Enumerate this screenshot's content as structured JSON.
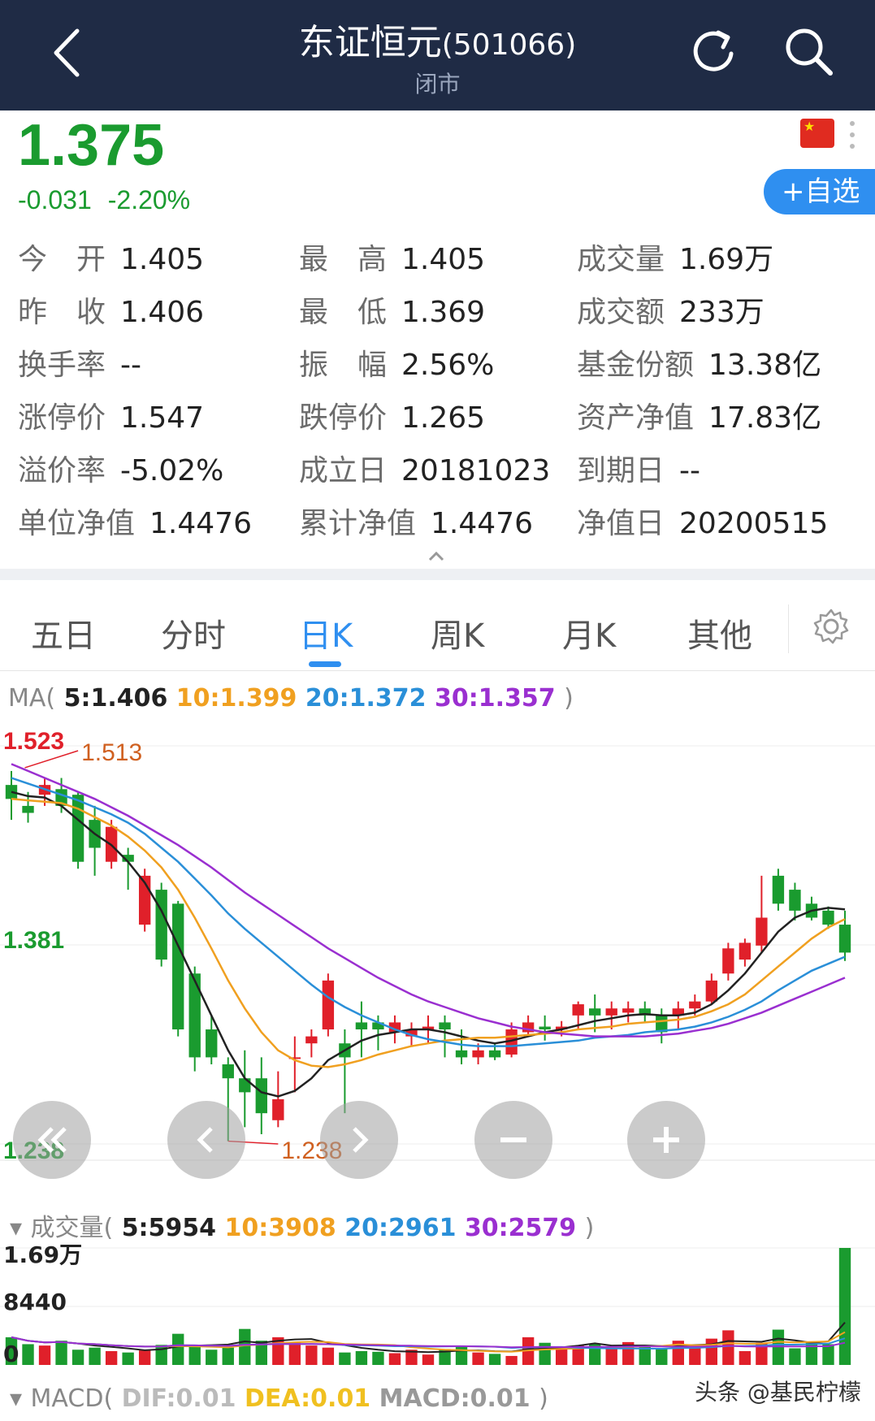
{
  "header": {
    "title": "东证恒元",
    "code": "(501066)",
    "status": "闭市"
  },
  "quote": {
    "price": "1.375",
    "change": "-0.031",
    "change_pct": "-2.20%",
    "watch_label": "+自选"
  },
  "stats": [
    [
      {
        "label": "今　开",
        "value": "1.405"
      },
      {
        "label": "最　高",
        "value": "1.405"
      },
      {
        "label": "成交量",
        "value": "1.69万"
      }
    ],
    [
      {
        "label": "昨　收",
        "value": "1.406"
      },
      {
        "label": "最　低",
        "value": "1.369"
      },
      {
        "label": "成交额",
        "value": "233万"
      }
    ],
    [
      {
        "label": "换手率",
        "value": "--"
      },
      {
        "label": "振　幅",
        "value": "2.56%"
      },
      {
        "label": "基金份额",
        "value": "13.38亿"
      }
    ],
    [
      {
        "label": "涨停价",
        "value": "1.547"
      },
      {
        "label": "跌停价",
        "value": "1.265"
      },
      {
        "label": "资产净值",
        "value": "17.83亿"
      }
    ],
    [
      {
        "label": "溢价率",
        "value": "-5.02%"
      },
      {
        "label": "成立日",
        "value": "20181023"
      },
      {
        "label": "到期日",
        "value": "--"
      }
    ],
    [
      {
        "label": "单位净值",
        "value": "1.4476"
      },
      {
        "label": "累计净值",
        "value": "1.4476"
      },
      {
        "label": "净值日",
        "value": "20200515"
      }
    ]
  ],
  "tabs": [
    "五日",
    "分时",
    "日K",
    "周K",
    "月K",
    "其他"
  ],
  "active_tab": "日K",
  "ma": {
    "prefix": "MA(",
    "m5": "5:1.406",
    "m10": "10:1.399",
    "m20": "20:1.372",
    "m30": "30:1.357",
    "suffix": ")"
  },
  "volume": {
    "prefix": "成交量(",
    "m5": "5:5954",
    "m10": "10:3908",
    "m20": "20:2961",
    "m30": "30:2579",
    "suffix": ")",
    "label_top": "1.69万",
    "label_mid": "8440",
    "label_zero": "0"
  },
  "macd": {
    "prefix": "MACD(",
    "dif": "DIF:0.01",
    "dea": "DEA:0.01",
    "macd": "MACD:0.01",
    "suffix": ")"
  },
  "watermark": "头条 @基民柠檬",
  "colors": {
    "up": "#e0202a",
    "down": "#1a9b2f",
    "ma5": "#222222",
    "ma10": "#f0a020",
    "ma20": "#2a8fd8",
    "ma30": "#9a2fd0",
    "header_bg": "#1f2b45",
    "accent": "#2f8ff0"
  },
  "chart_data": {
    "type": "candlestick",
    "ylim": [
      1.238,
      1.523
    ],
    "y_tick_labels": [
      "1.523",
      "1.381",
      "1.238"
    ],
    "annotations": [
      {
        "label": "1.513"
      },
      {
        "label": "1.238"
      }
    ],
    "candles": [
      [
        1.495,
        1.485,
        1.505,
        1.47
      ],
      [
        1.48,
        1.475,
        1.49,
        1.468
      ],
      [
        1.488,
        1.495,
        1.5,
        1.48
      ],
      [
        1.492,
        1.48,
        1.5,
        1.475
      ],
      [
        1.488,
        1.44,
        1.49,
        1.435
      ],
      [
        1.47,
        1.45,
        1.48,
        1.43
      ],
      [
        1.44,
        1.465,
        1.47,
        1.435
      ],
      [
        1.445,
        1.44,
        1.45,
        1.42
      ],
      [
        1.395,
        1.43,
        1.435,
        1.39
      ],
      [
        1.42,
        1.37,
        1.425,
        1.365
      ],
      [
        1.41,
        1.32,
        1.412,
        1.315
      ],
      [
        1.36,
        1.3,
        1.365,
        1.29
      ],
      [
        1.32,
        1.3,
        1.33,
        1.295
      ],
      [
        1.295,
        1.285,
        1.3,
        1.24
      ],
      [
        1.285,
        1.275,
        1.305,
        1.25
      ],
      [
        1.285,
        1.26,
        1.3,
        1.245
      ],
      [
        1.255,
        1.27,
        1.29,
        1.25
      ],
      [
        1.3,
        1.3,
        1.315,
        1.275
      ],
      [
        1.31,
        1.315,
        1.32,
        1.3
      ],
      [
        1.32,
        1.355,
        1.36,
        1.315
      ],
      [
        1.31,
        1.3,
        1.32,
        1.26
      ],
      [
        1.325,
        1.32,
        1.34,
        1.3
      ],
      [
        1.325,
        1.32,
        1.33,
        1.305
      ],
      [
        1.318,
        1.325,
        1.33,
        1.31
      ],
      [
        1.315,
        1.32,
        1.325,
        1.308
      ],
      [
        1.32,
        1.322,
        1.33,
        1.31
      ],
      [
        1.325,
        1.32,
        1.33,
        1.3
      ],
      [
        1.305,
        1.3,
        1.32,
        1.295
      ],
      [
        1.3,
        1.305,
        1.31,
        1.295
      ],
      [
        1.305,
        1.3,
        1.31,
        1.298
      ],
      [
        1.302,
        1.32,
        1.325,
        1.3
      ],
      [
        1.318,
        1.325,
        1.33,
        1.315
      ],
      [
        1.322,
        1.32,
        1.33,
        1.312
      ],
      [
        1.32,
        1.322,
        1.326,
        1.315
      ],
      [
        1.33,
        1.338,
        1.34,
        1.32
      ],
      [
        1.335,
        1.33,
        1.345,
        1.318
      ],
      [
        1.33,
        1.335,
        1.34,
        1.32
      ],
      [
        1.332,
        1.335,
        1.34,
        1.325
      ],
      [
        1.335,
        1.33,
        1.34,
        1.325
      ],
      [
        1.33,
        1.318,
        1.335,
        1.31
      ],
      [
        1.33,
        1.335,
        1.34,
        1.32
      ],
      [
        1.335,
        1.34,
        1.345,
        1.33
      ],
      [
        1.34,
        1.355,
        1.36,
        1.338
      ],
      [
        1.36,
        1.378,
        1.382,
        1.355
      ],
      [
        1.37,
        1.382,
        1.385,
        1.365
      ],
      [
        1.38,
        1.4,
        1.43,
        1.375
      ],
      [
        1.43,
        1.41,
        1.435,
        1.405
      ],
      [
        1.42,
        1.405,
        1.425,
        1.398
      ],
      [
        1.41,
        1.4,
        1.415,
        1.398
      ],
      [
        1.405,
        1.395,
        1.408,
        1.392
      ],
      [
        1.395,
        1.375,
        1.405,
        1.369
      ]
    ],
    "ma5": [
      1.49,
      1.487,
      1.486,
      1.48,
      1.47,
      1.46,
      1.452,
      1.44,
      1.425,
      1.405,
      1.38,
      1.355,
      1.33,
      1.305,
      1.285,
      1.275,
      1.272,
      1.276,
      1.285,
      1.298,
      1.305,
      1.312,
      1.316,
      1.318,
      1.32,
      1.32,
      1.318,
      1.315,
      1.312,
      1.31,
      1.312,
      1.315,
      1.318,
      1.32,
      1.323,
      1.326,
      1.328,
      1.33,
      1.331,
      1.33,
      1.33,
      1.332,
      1.338,
      1.348,
      1.36,
      1.375,
      1.39,
      1.4,
      1.405,
      1.407,
      1.406
    ],
    "ma10": [
      1.485,
      1.484,
      1.483,
      1.482,
      1.478,
      1.472,
      1.466,
      1.458,
      1.448,
      1.436,
      1.42,
      1.4,
      1.378,
      1.355,
      1.335,
      1.318,
      1.305,
      1.298,
      1.294,
      1.293,
      1.295,
      1.298,
      1.302,
      1.305,
      1.308,
      1.31,
      1.312,
      1.313,
      1.314,
      1.314,
      1.315,
      1.316,
      1.317,
      1.318,
      1.32,
      1.321,
      1.322,
      1.324,
      1.325,
      1.326,
      1.327,
      1.329,
      1.333,
      1.338,
      1.345,
      1.355,
      1.365,
      1.375,
      1.385,
      1.393,
      1.399
    ],
    "ma20": [
      1.5,
      1.496,
      1.492,
      1.488,
      1.484,
      1.479,
      1.474,
      1.468,
      1.46,
      1.45,
      1.44,
      1.428,
      1.416,
      1.403,
      1.392,
      1.382,
      1.372,
      1.362,
      1.352,
      1.343,
      1.336,
      1.33,
      1.325,
      1.32,
      1.316,
      1.313,
      1.311,
      1.309,
      1.308,
      1.308,
      1.308,
      1.309,
      1.31,
      1.311,
      1.312,
      1.314,
      1.315,
      1.316,
      1.318,
      1.319,
      1.32,
      1.322,
      1.325,
      1.329,
      1.334,
      1.34,
      1.348,
      1.355,
      1.362,
      1.367,
      1.372
    ],
    "ma30": [
      1.51,
      1.505,
      1.5,
      1.495,
      1.49,
      1.485,
      1.479,
      1.473,
      1.466,
      1.459,
      1.452,
      1.444,
      1.436,
      1.427,
      1.418,
      1.41,
      1.402,
      1.394,
      1.386,
      1.378,
      1.371,
      1.364,
      1.357,
      1.351,
      1.345,
      1.34,
      1.336,
      1.332,
      1.328,
      1.325,
      1.322,
      1.32,
      1.318,
      1.317,
      1.316,
      1.315,
      1.315,
      1.315,
      1.315,
      1.316,
      1.317,
      1.319,
      1.321,
      1.324,
      1.328,
      1.332,
      1.337,
      1.342,
      1.347,
      1.352,
      1.357
    ],
    "volumes": [
      4000,
      3000,
      2800,
      3500,
      2200,
      2500,
      2000,
      1800,
      2100,
      2900,
      4500,
      2600,
      2200,
      2500,
      5200,
      3500,
      4000,
      3200,
      2800,
      2500,
      1800,
      2000,
      1900,
      1700,
      2200,
      1500,
      2300,
      2700,
      1800,
      1600,
      1300,
      4000,
      3200,
      2600,
      2800,
      3000,
      2400,
      3300,
      2600,
      2300,
      3500,
      2700,
      3800,
      5000,
      2000,
      3200,
      5100,
      2400,
      3300,
      3000,
      16900
    ],
    "volume_ylim": [
      0,
      16900
    ]
  }
}
